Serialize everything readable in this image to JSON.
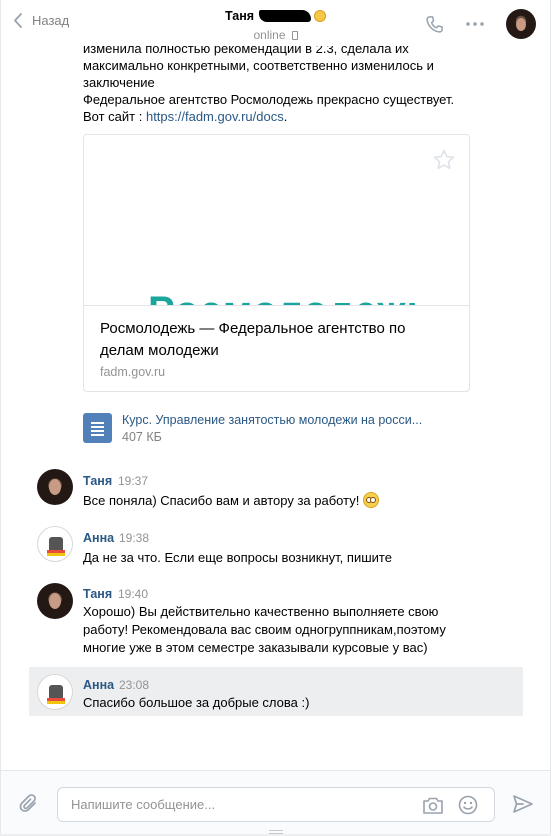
{
  "header": {
    "back_label": "Назад",
    "peer_name": "Таня",
    "peer_status": "online",
    "icons": [
      "chevron-left-icon",
      "phone-icon",
      "more-icon",
      "mobile-icon"
    ]
  },
  "history": {
    "partial_message": {
      "line1": "изменила полностью рекомендации в 2.3, сделала их",
      "line2": "максимально конкретными, соответственно изменилось и",
      "line3": "заключение",
      "line4": "Федеральное агентство Росмолодежь прекрасно существует.",
      "line5_prefix": "Вот сайт : ",
      "link": "https://fadm.gov.ru/docs",
      "line5_suffix": "."
    },
    "link_card": {
      "thumb_text": "Росмолодежь",
      "title": "Росмолодежь — Федеральное агентство по делам молодежи",
      "domain": "fadm.gov.ru"
    },
    "document": {
      "name": "Курс. Управление занятостью молодежи на росси...",
      "size": "407 КБ"
    },
    "messages": [
      {
        "author": "Таня",
        "time": "19:37",
        "text": "Все поняла) Спасибо вам и автору за работу!",
        "emoji": true
      },
      {
        "author": "Анна",
        "time": "19:38",
        "text": "Да не за что. Если еще вопросы возникнут, пишите"
      },
      {
        "author": "Таня",
        "time": "19:40",
        "text": "Хорошо) Вы действительно качественно выполняете свою работу! Рекомендовала вас своим одногруппникам,поэтому многие уже в этом семестре заказывали курсовые у вас)"
      },
      {
        "author": "Анна",
        "time": "23:08",
        "text": "Спасибо большое за добрые слова :)"
      }
    ]
  },
  "composer": {
    "placeholder": "Напишите сообщение...",
    "icons": [
      "paperclip-icon",
      "camera-icon",
      "smile-icon",
      "send-icon"
    ]
  },
  "colors": {
    "link": "#2a5885",
    "accent": "#5181b8",
    "selected_bg": "#edeef0",
    "brand_teal": "#1aa69d"
  }
}
